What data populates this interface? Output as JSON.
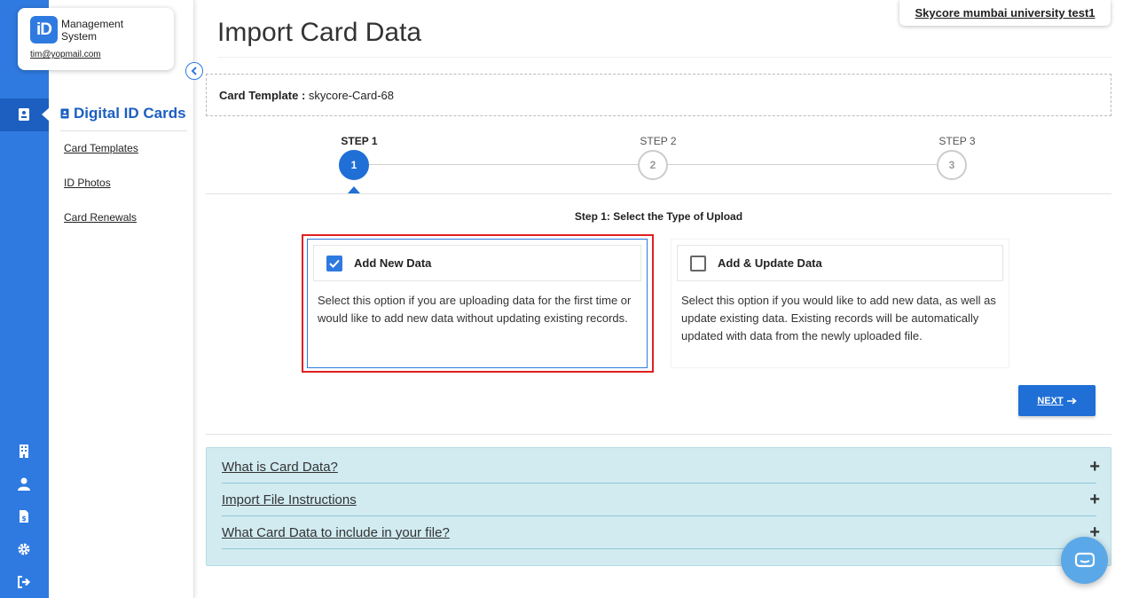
{
  "brand": {
    "logo_text": "iD",
    "name_line1": "Management",
    "name_line2": "System",
    "email": "tim@yopmail.com"
  },
  "rail": {
    "top_icons": [
      "id-card-icon"
    ],
    "bottom_icons": [
      "building-icon",
      "user-icon",
      "invoice-icon",
      "gear-icon",
      "logout-icon"
    ]
  },
  "sidebar": {
    "section_title": "Digital ID Cards",
    "items": [
      {
        "label": "Card Templates"
      },
      {
        "label": "ID Photos"
      },
      {
        "label": "Card Renewals"
      }
    ]
  },
  "header": {
    "title": "Import Card Data",
    "org_name": "Skycore mumbai university test1"
  },
  "template": {
    "label": "Card Template :",
    "value": "skycore-Card-68"
  },
  "stepper": {
    "steps": [
      {
        "label": "STEP 1",
        "number": "1",
        "active": true
      },
      {
        "label": "STEP 2",
        "number": "2",
        "active": false
      },
      {
        "label": "STEP 3",
        "number": "3",
        "active": false
      }
    ]
  },
  "step1": {
    "heading": "Step 1: Select the Type of Upload",
    "options": [
      {
        "title": "Add New Data",
        "checked": true,
        "description": "Select this option if you are uploading data for the first time or would like to add new data without updating existing records."
      },
      {
        "title": "Add & Update Data",
        "checked": false,
        "description": "Select this option if you would like to add new data, as well as update existing data. Existing records will be automatically updated with data from the newly uploaded file."
      }
    ],
    "next_label": "NEXT"
  },
  "accordion": {
    "items": [
      {
        "label": "What is Card Data?"
      },
      {
        "label": "Import File Instructions"
      },
      {
        "label": "What Card Data to include in your file?"
      }
    ],
    "expand_symbol": "+"
  },
  "colors": {
    "primary": "#2f7ae0",
    "primary_dark": "#1f6fd6",
    "highlight": "#e02020",
    "accordion_bg": "#d1ebf1"
  }
}
